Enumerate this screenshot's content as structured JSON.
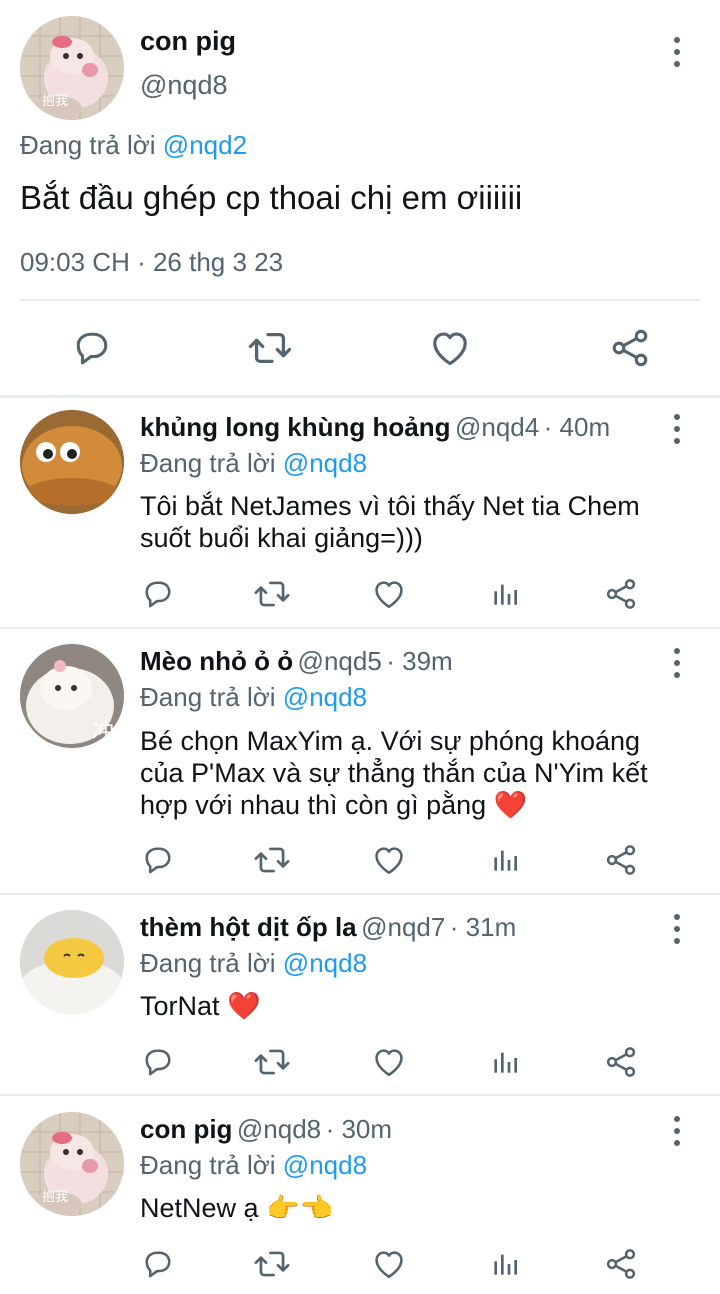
{
  "main_tweet": {
    "name": "con pig",
    "handle": "@nqd8",
    "replying_prefix": "Đang trả lời",
    "replying_to": "@nqd2",
    "text": "Bắt đầu ghép cp thoai chị em ơiiiiii",
    "timestamp": "09:03 CH · 26 thg 3 23",
    "avatar_caption": "抱我"
  },
  "replies": [
    {
      "name": "khủng long khùng hoảng",
      "handle": "@nqd4",
      "time": "· 40m",
      "replying_prefix": "Đang trả lời",
      "replying_to": "@nqd8",
      "text_line1": "Tôi bắt NetJames vì tôi thấy Net tia Chem",
      "text_line2": "suốt buổi khai giảng=)))"
    },
    {
      "name": "Mèo nhỏ ỏ ỏ",
      "handle": "@nqd5",
      "time": "· 39m",
      "replying_prefix": "Đang trả lời",
      "replying_to": "@nqd8",
      "text_line1": "Bé chọn MaxYim ạ. Với sự phóng khoáng",
      "text_line2": "của P'Max và sự thẳng thắn của N'Yim kết",
      "text_line3": "hợp với nhau thì còn gì pằng ❤️",
      "avatar_caption": "冲"
    },
    {
      "name": "thèm hột dịt ốp la",
      "handle": "@nqd7",
      "time": "· 31m",
      "replying_prefix": "Đang trả lời",
      "replying_to": "@nqd8",
      "text_line1": "TorNat ❤️"
    },
    {
      "name": "con pig",
      "handle": "@nqd8",
      "time": "· 30m",
      "replying_prefix": "Đang trả lời",
      "replying_to": "@nqd8",
      "text_line1": "NetNew ạ 👉👈",
      "avatar_caption": "抱我"
    }
  ],
  "colors": {
    "link": "#1d9bf0",
    "secondary_text": "#536471",
    "divider": "#e6ecf0",
    "icon": "#536471"
  },
  "icons": [
    "reply-icon",
    "retweet-icon",
    "like-icon",
    "analytics-icon",
    "share-icon",
    "more-icon"
  ]
}
